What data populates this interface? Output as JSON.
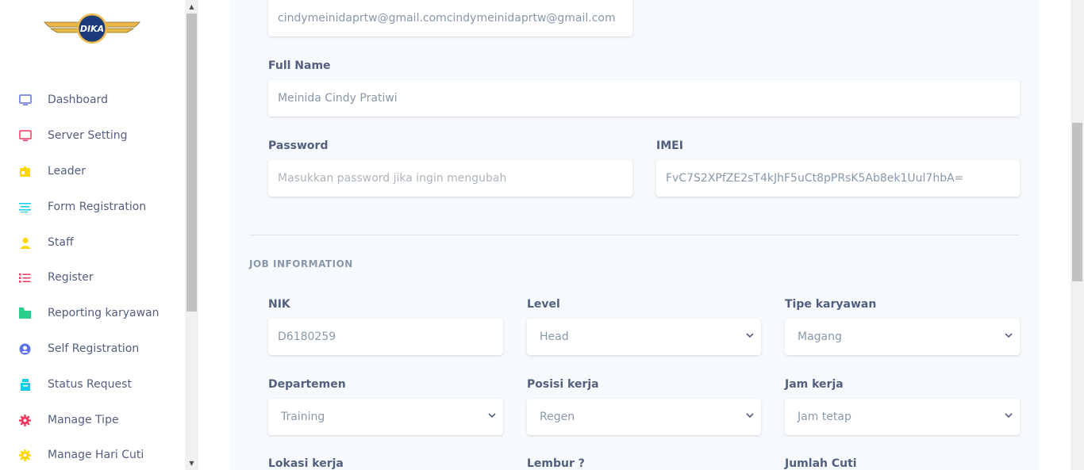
{
  "brand": {
    "logo_text": "DIKA"
  },
  "sidebar": {
    "items": [
      {
        "label": "Dashboard",
        "icon": "monitor-icon",
        "color": "#5e72e4"
      },
      {
        "label": "Server Setting",
        "icon": "monitor-icon",
        "color": "#f5365c"
      },
      {
        "label": "Leader",
        "icon": "badge-icon",
        "color": "#ffd600"
      },
      {
        "label": "Form Registration",
        "icon": "align-left-icon",
        "color": "#11cdef"
      },
      {
        "label": "Staff",
        "icon": "user-icon",
        "color": "#ffd600"
      },
      {
        "label": "Register",
        "icon": "list-icon",
        "color": "#f5365c"
      },
      {
        "label": "Reporting karyawan",
        "icon": "folder-icon",
        "color": "#2dce89"
      },
      {
        "label": "Self Registration",
        "icon": "user-circle-icon",
        "color": "#5e72e4"
      },
      {
        "label": "Status Request",
        "icon": "archive-icon",
        "color": "#11cdef"
      },
      {
        "label": "Manage Tipe",
        "icon": "gear-icon",
        "color": "#f5365c"
      },
      {
        "label": "Manage Hari Cuti",
        "icon": "gear-icon",
        "color": "#ffd600"
      }
    ]
  },
  "form": {
    "email": {
      "value": "cindymeinidaprtw@gmail.comcindymeinidaprtw@gmail.com"
    },
    "full_name": {
      "label": "Full Name",
      "value": "Meinida Cindy Pratiwi"
    },
    "password": {
      "label": "Password",
      "placeholder": "Masukkan password jika ingin mengubah"
    },
    "imei": {
      "label": "IMEI",
      "value": "FvC7S2XPfZE2sT4kJhF5uCt8pPRsK5Ab8ek1Uul7hbA="
    }
  },
  "job": {
    "section_title": "JOB INFORMATION",
    "nik": {
      "label": "NIK",
      "value": "D6180259"
    },
    "level": {
      "label": "Level",
      "value": "Head"
    },
    "tipe": {
      "label": "Tipe karyawan",
      "value": "Magang"
    },
    "departemen": {
      "label": "Departemen",
      "value": "Training"
    },
    "posisi": {
      "label": "Posisi kerja",
      "value": "Regen"
    },
    "jam": {
      "label": "Jam kerja",
      "value": "Jam tetap"
    },
    "lokasi": {
      "label": "Lokasi kerja"
    },
    "lembur": {
      "label": "Lembur ?"
    },
    "cuti": {
      "label": "Jumlah Cuti"
    }
  }
}
